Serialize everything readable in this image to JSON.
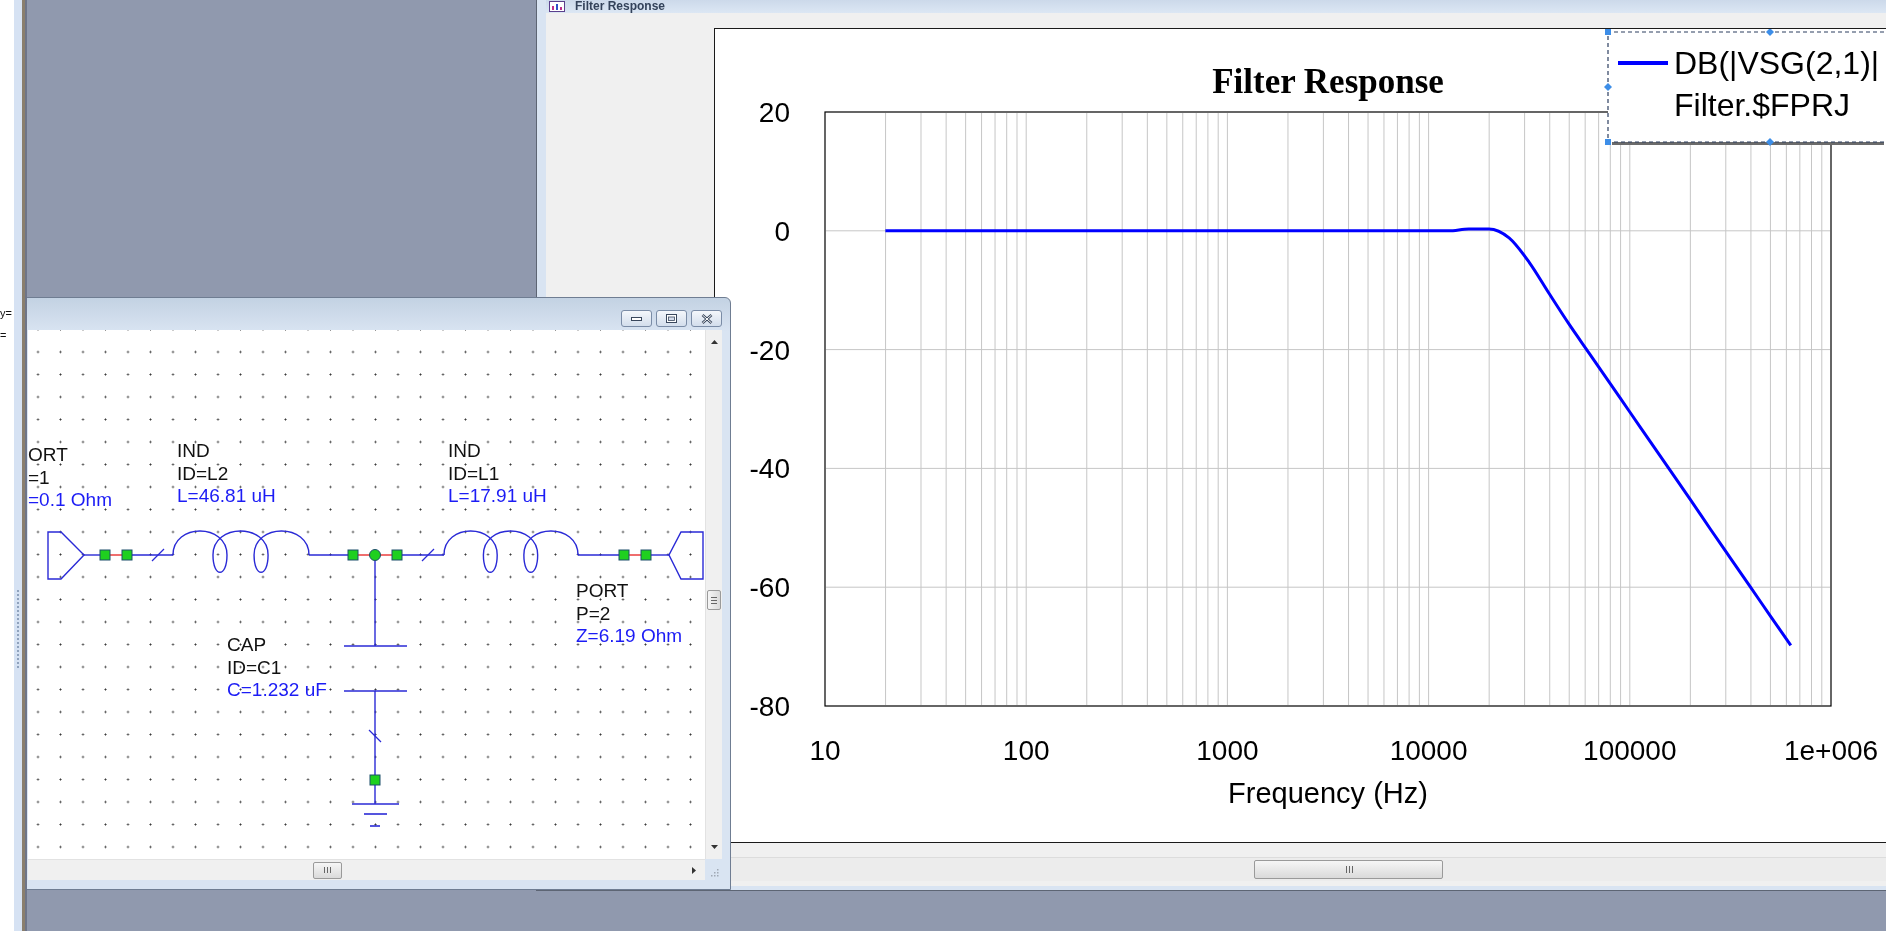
{
  "side_panel": {
    "lines": [
      "y=",
      "="
    ]
  },
  "chart_window": {
    "title": "Filter Response",
    "chart": {
      "chart_data": {
        "type": "line",
        "title": "Filter Response",
        "xlabel": "Frequency (Hz)",
        "categories": [
          "10",
          null,
          null,
          null,
          null,
          null,
          null,
          null,
          null,
          null,
          "100",
          null,
          null,
          null,
          null,
          null,
          null,
          null,
          null,
          null,
          "1000",
          null,
          null,
          null,
          null,
          null,
          null,
          null,
          null,
          null,
          "10000",
          null,
          null,
          null,
          null,
          null,
          null,
          null,
          null,
          null,
          "100000",
          null,
          null,
          null,
          null,
          null,
          null,
          null,
          null,
          null,
          "1e+006"
        ],
        "series": [
          {
            "name": "DB(|VSG(2,1)|",
            "color": "#0000ff",
            "values": [
              null,
              null,
              null,
              0,
              0,
              0,
              0,
              0,
              0,
              0,
              0,
              0,
              0,
              0,
              0,
              0,
              0,
              0,
              0,
              0,
              0,
              0,
              0,
              0,
              0,
              0,
              0,
              0,
              0,
              0,
              0,
              0,
              0.3,
              0.3,
              -1.2,
              -5.3,
              -10.6,
              -15.8,
              -20.7,
              -25.6,
              -30.5,
              -35.4,
              -40.3,
              -45.2,
              -50.2,
              -55.1,
              -60,
              -64.9,
              -69.8,
              null,
              null
            ]
          }
        ],
        "ylim": [
          -80,
          20
        ],
        "yticks": [
          20,
          0,
          -20,
          -40,
          -60,
          -80
        ],
        "grid": true
      },
      "legend": {
        "selected": true,
        "source": "Filter.$FPRJ"
      }
    }
  },
  "schematic_window": {
    "components": [
      {
        "kind": "port",
        "labels": [
          {
            "kind": "name",
            "text": "ORT"
          },
          {
            "kind": "id",
            "text": "=1"
          },
          {
            "kind": "value",
            "text": "=0.1 Ohm"
          }
        ]
      },
      {
        "kind": "inductor",
        "labels": [
          {
            "kind": "name",
            "text": "IND"
          },
          {
            "kind": "id",
            "text": "ID=L2"
          },
          {
            "kind": "value",
            "text": "L=46.81 uH"
          }
        ]
      },
      {
        "kind": "capacitor",
        "labels": [
          {
            "kind": "name",
            "text": "CAP"
          },
          {
            "kind": "id",
            "text": "ID=C1"
          },
          {
            "kind": "value",
            "text": "C=1.232 uF"
          }
        ]
      },
      {
        "kind": "inductor",
        "labels": [
          {
            "kind": "name",
            "text": "IND"
          },
          {
            "kind": "id",
            "text": "ID=L1"
          },
          {
            "kind": "value",
            "text": "L=17.91 uH"
          }
        ]
      },
      {
        "kind": "port",
        "labels": [
          {
            "kind": "name",
            "text": "PORT"
          },
          {
            "kind": "id",
            "text": "P=2"
          },
          {
            "kind": "value",
            "text": "Z=6.19 Ohm"
          }
        ]
      },
      {
        "kind": "ground"
      }
    ]
  }
}
